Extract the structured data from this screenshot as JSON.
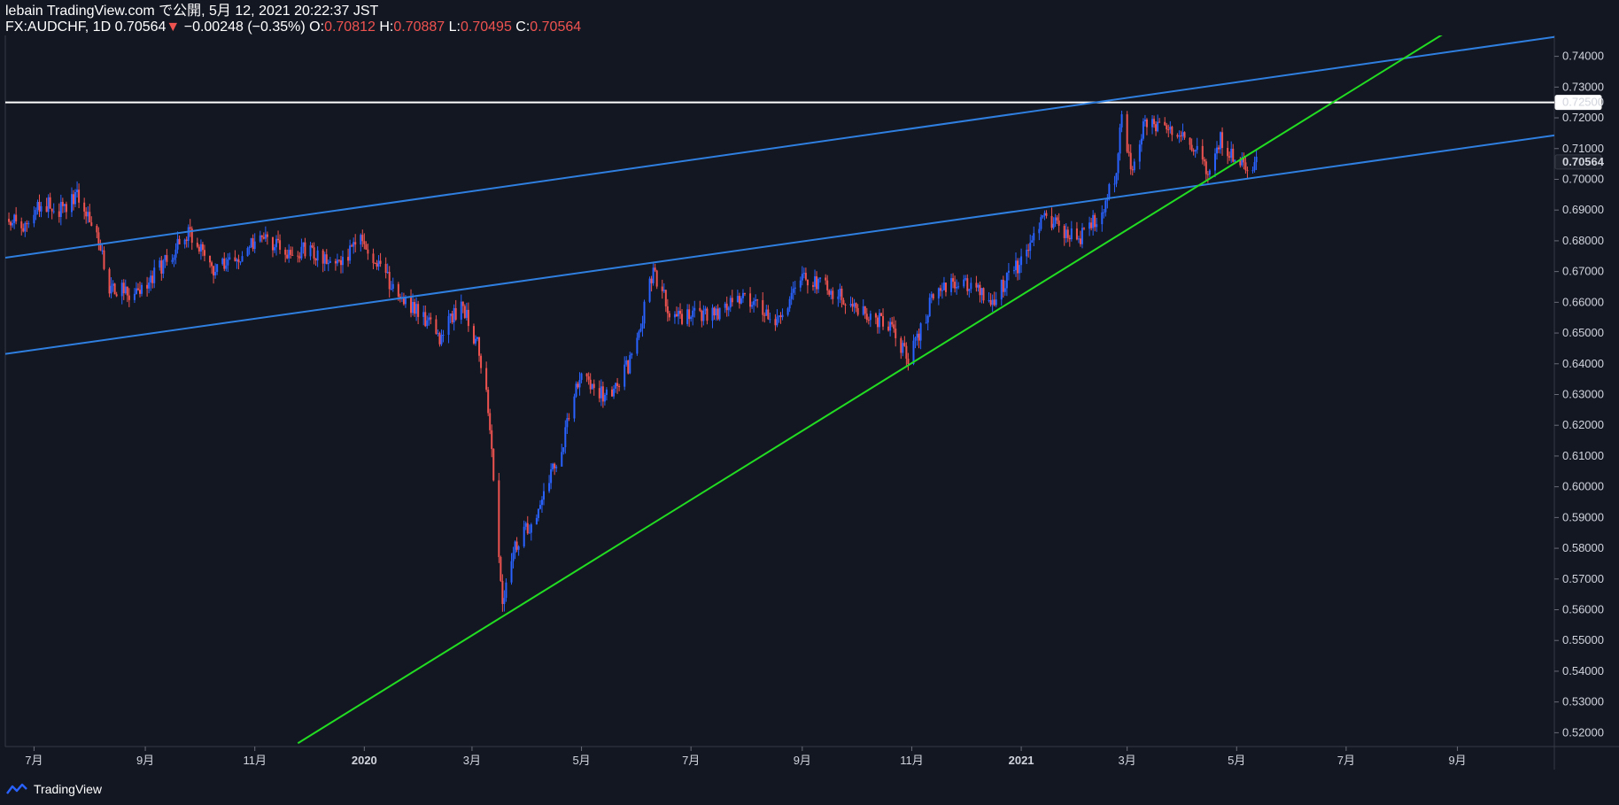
{
  "header": {
    "publish_line": "lebain TradingView.com で公開, 5月 12, 2021 20:22:37 JST",
    "symbol": "FX:AUDCHF, 1D",
    "last": "0.70564",
    "arrow": "▼",
    "change": "−0.00248 (−0.35%)",
    "o_label": "O:",
    "o_value": "0.70812",
    "h_label": "H:",
    "h_value": "0.70887",
    "l_label": "L:",
    "l_value": "0.70495",
    "c_label": "C:",
    "c_value": "0.70564"
  },
  "footer": {
    "brand": "TradingView"
  },
  "colors": {
    "background": "#131722",
    "up": "#2962ff",
    "down": "#ef5350",
    "channel": "#2f7fe0",
    "trendline": "#22dd22",
    "level": "#ffffff",
    "axis": "#363a45"
  },
  "chart_data": {
    "type": "candlestick",
    "symbol": "FX:AUDCHF",
    "interval": "1D",
    "y_ticks": [
      "0.74000",
      "0.73000",
      "0.72000",
      "0.71000",
      "0.70000",
      "0.69000",
      "0.68000",
      "0.67000",
      "0.66000",
      "0.65000",
      "0.64000",
      "0.63000",
      "0.62000",
      "0.61000",
      "0.60000",
      "0.59000",
      "0.58000",
      "0.57000",
      "0.56000",
      "0.55000",
      "0.54000",
      "0.53000",
      "0.52000"
    ],
    "ylim": [
      0.5155,
      0.7468
    ],
    "x_ticks": [
      {
        "label": "7月",
        "date": "2019-07-01"
      },
      {
        "label": "9月",
        "date": "2019-09-01"
      },
      {
        "label": "11月",
        "date": "2019-11-01"
      },
      {
        "label": "2020",
        "date": "2020-01-01",
        "bold": true
      },
      {
        "label": "3月",
        "date": "2020-03-01"
      },
      {
        "label": "5月",
        "date": "2020-05-01"
      },
      {
        "label": "7月",
        "date": "2020-07-01"
      },
      {
        "label": "9月",
        "date": "2020-09-01"
      },
      {
        "label": "11月",
        "date": "2020-11-01"
      },
      {
        "label": "2021",
        "date": "2021-01-01",
        "bold": true
      },
      {
        "label": "3月",
        "date": "2021-03-01"
      },
      {
        "label": "5月",
        "date": "2021-05-01"
      },
      {
        "label": "7月",
        "date": "2021-07-01"
      },
      {
        "label": "9月",
        "date": "2021-09-01"
      }
    ],
    "xlim": [
      "2019-06-15",
      "2021-10-25"
    ],
    "price_labels": [
      {
        "value": 0.725,
        "text": "0.72500",
        "style": "level"
      },
      {
        "value": 0.70564,
        "text": "0.70564",
        "style": "last"
      }
    ],
    "horizontal_lines": [
      {
        "value": 0.725
      }
    ],
    "trendlines": [
      {
        "name": "channel-upper",
        "style": "channel",
        "p1": {
          "date": "2019-06-15",
          "value": 0.6745
        },
        "p2": {
          "date": "2021-10-25",
          "value": 0.7463
        }
      },
      {
        "name": "channel-lower",
        "style": "channel",
        "p1": {
          "date": "2019-06-15",
          "value": 0.6432
        },
        "p2": {
          "date": "2021-10-25",
          "value": 0.7143
        }
      },
      {
        "name": "support",
        "style": "trendline",
        "p1": {
          "date": "2020-03-18",
          "value": 0.5578
        },
        "p2": {
          "date": "2020-10-30",
          "value": 0.6395
        }
      }
    ],
    "anchors": [
      {
        "date": "2019-06-15",
        "value": 0.689
      },
      {
        "date": "2019-06-25",
        "value": 0.683
      },
      {
        "date": "2019-07-05",
        "value": 0.693
      },
      {
        "date": "2019-07-15",
        "value": 0.69
      },
      {
        "date": "2019-07-25",
        "value": 0.694
      },
      {
        "date": "2019-08-05",
        "value": 0.683
      },
      {
        "date": "2019-08-12",
        "value": 0.665
      },
      {
        "date": "2019-08-26",
        "value": 0.663
      },
      {
        "date": "2019-09-12",
        "value": 0.673
      },
      {
        "date": "2019-09-25",
        "value": 0.683
      },
      {
        "date": "2019-10-10",
        "value": 0.67
      },
      {
        "date": "2019-10-25",
        "value": 0.676
      },
      {
        "date": "2019-11-05",
        "value": 0.683
      },
      {
        "date": "2019-11-15",
        "value": 0.677
      },
      {
        "date": "2019-12-01",
        "value": 0.677
      },
      {
        "date": "2019-12-15",
        "value": 0.672
      },
      {
        "date": "2019-12-31",
        "value": 0.68
      },
      {
        "date": "2020-01-15",
        "value": 0.667
      },
      {
        "date": "2020-02-01",
        "value": 0.656
      },
      {
        "date": "2020-02-12",
        "value": 0.649
      },
      {
        "date": "2020-02-24",
        "value": 0.659
      },
      {
        "date": "2020-03-05",
        "value": 0.645
      },
      {
        "date": "2020-03-10",
        "value": 0.626
      },
      {
        "date": "2020-03-18",
        "value": 0.563
      },
      {
        "date": "2020-03-25",
        "value": 0.58
      },
      {
        "date": "2020-04-05",
        "value": 0.59
      },
      {
        "date": "2020-04-20",
        "value": 0.613
      },
      {
        "date": "2020-04-30",
        "value": 0.637
      },
      {
        "date": "2020-05-15",
        "value": 0.629
      },
      {
        "date": "2020-05-30",
        "value": 0.642
      },
      {
        "date": "2020-06-10",
        "value": 0.671
      },
      {
        "date": "2020-06-20",
        "value": 0.655
      },
      {
        "date": "2020-07-15",
        "value": 0.656
      },
      {
        "date": "2020-07-31",
        "value": 0.662
      },
      {
        "date": "2020-08-20",
        "value": 0.654
      },
      {
        "date": "2020-09-01",
        "value": 0.668
      },
      {
        "date": "2020-09-20",
        "value": 0.663
      },
      {
        "date": "2020-10-05",
        "value": 0.656
      },
      {
        "date": "2020-10-20",
        "value": 0.653
      },
      {
        "date": "2020-10-30",
        "value": 0.641
      },
      {
        "date": "2020-11-15",
        "value": 0.665
      },
      {
        "date": "2020-12-01",
        "value": 0.666
      },
      {
        "date": "2020-12-15",
        "value": 0.66
      },
      {
        "date": "2020-12-30",
        "value": 0.672
      },
      {
        "date": "2021-01-15",
        "value": 0.688
      },
      {
        "date": "2021-02-01",
        "value": 0.68
      },
      {
        "date": "2021-02-15",
        "value": 0.69
      },
      {
        "date": "2021-02-23",
        "value": 0.702
      },
      {
        "date": "2021-02-26",
        "value": 0.721
      },
      {
        "date": "2021-03-03",
        "value": 0.703
      },
      {
        "date": "2021-03-10",
        "value": 0.718
      },
      {
        "date": "2021-03-20",
        "value": 0.718
      },
      {
        "date": "2021-04-01",
        "value": 0.716
      },
      {
        "date": "2021-04-15",
        "value": 0.703
      },
      {
        "date": "2021-04-22",
        "value": 0.713
      },
      {
        "date": "2021-05-03",
        "value": 0.705
      },
      {
        "date": "2021-05-12",
        "value": 0.7056
      }
    ]
  }
}
